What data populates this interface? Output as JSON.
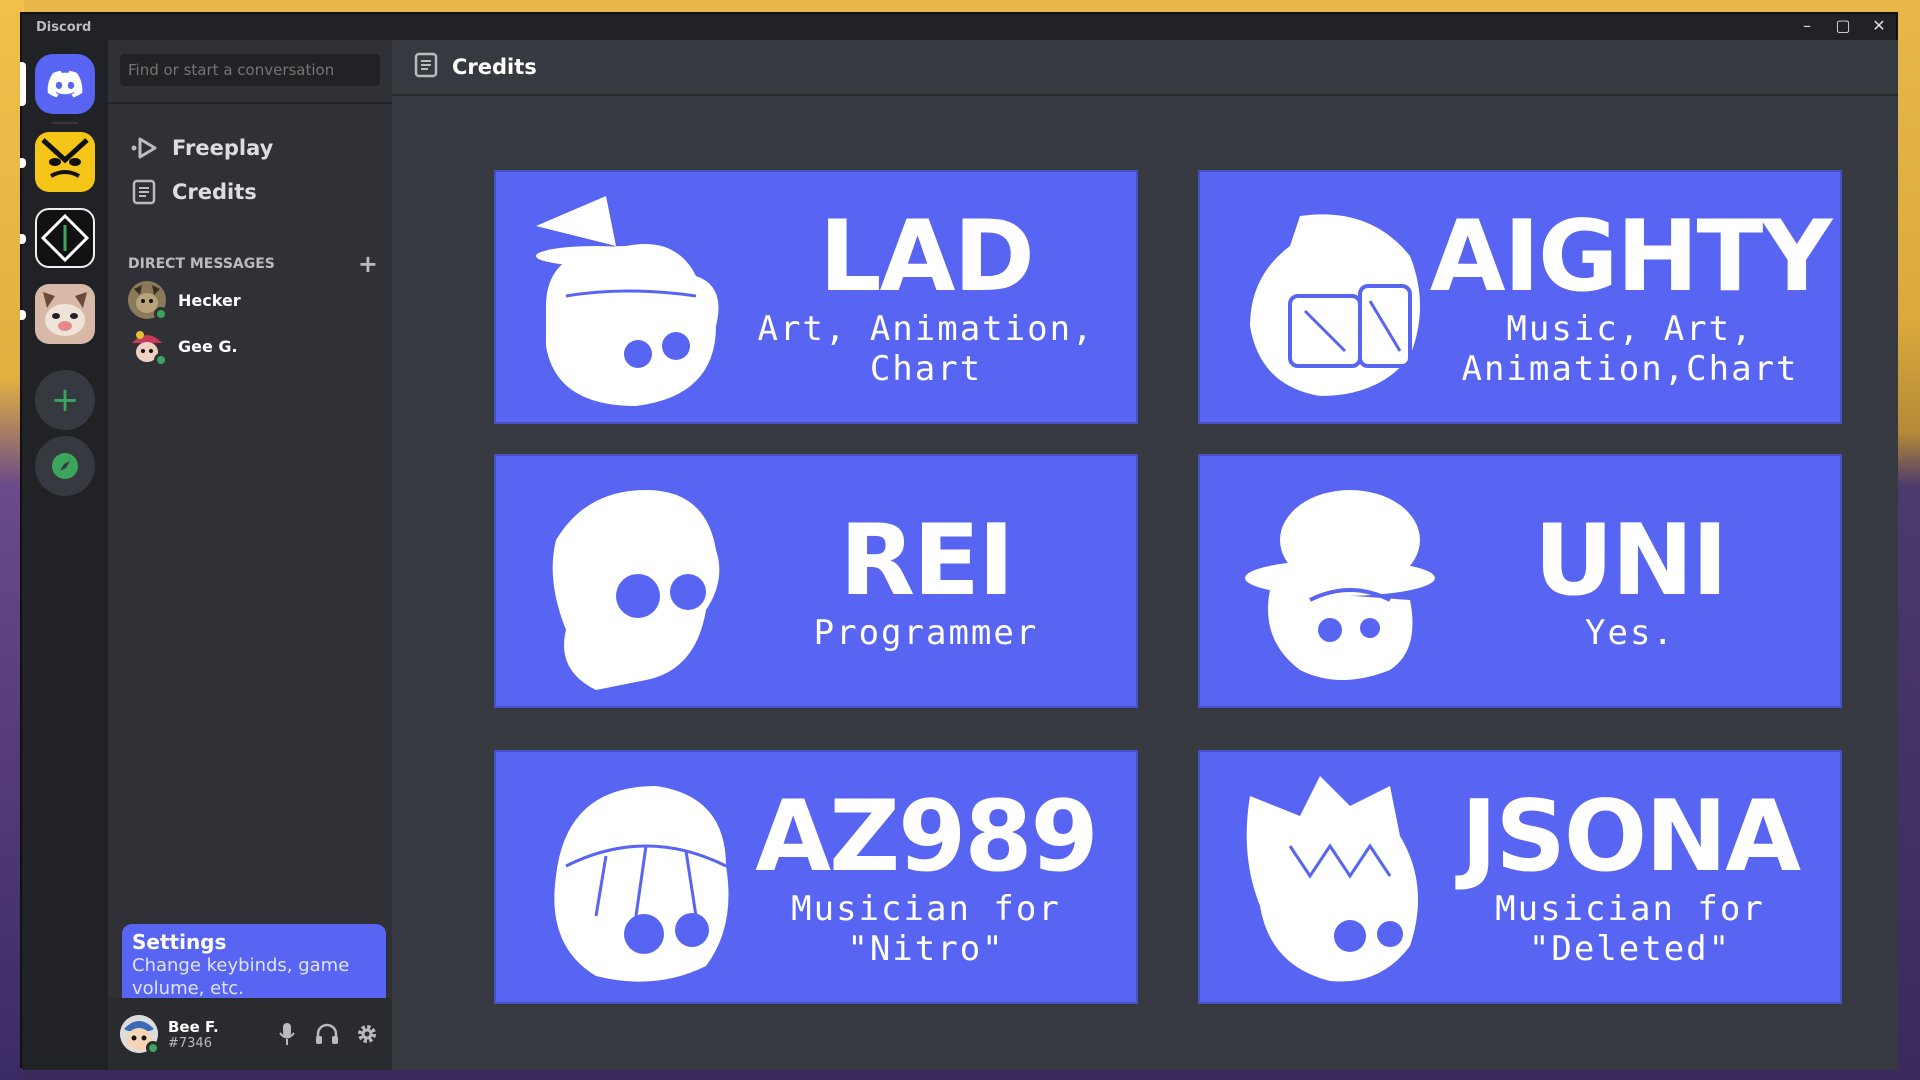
{
  "window": {
    "title": "Discord",
    "controls": {
      "minimize": "–",
      "maximize": "▢",
      "close": "✕"
    }
  },
  "colors": {
    "blurple": "#5865f2",
    "green": "#3ba55d",
    "rail": "#202225",
    "sidebar": "#2f3136",
    "main": "#36393f"
  },
  "rail": {
    "servers": [
      {
        "name": "Discord Home",
        "icon": "discord-logo-icon"
      },
      {
        "name": "Angry face server",
        "icon": "angry-face-icon"
      },
      {
        "name": "Diamond server",
        "icon": "diamond-icon"
      },
      {
        "name": "Cat server",
        "icon": "cat-face-icon"
      }
    ],
    "add_label": "+",
    "explore_icon": "compass-icon"
  },
  "sidebar": {
    "search_placeholder": "Find or start a conversation",
    "nav": [
      {
        "label": "Freeplay",
        "icon": "play-icon"
      },
      {
        "label": "Credits",
        "icon": "document-icon"
      }
    ],
    "dm_header": "DIRECT MESSAGES",
    "dm_add": "+",
    "dms": [
      {
        "name": "Hecker"
      },
      {
        "name": "Gee G."
      }
    ],
    "tooltip": {
      "title": "Settings",
      "description": "Change keybinds, game volume, etc."
    },
    "user": {
      "name": "Bee F.",
      "tag": "#7346"
    }
  },
  "main": {
    "header_title": "Credits",
    "header_icon": "document-icon",
    "cards": [
      {
        "name": "LAD",
        "role": "Art, Animation,\nChart"
      },
      {
        "name": "AIGHTY",
        "role": "Music, Art,\nAnimation,Chart"
      },
      {
        "name": "REI",
        "role": "Programmer"
      },
      {
        "name": "UNI",
        "role": "Yes."
      },
      {
        "name": "AZ989",
        "role": "Musician for\n\"Nitro\""
      },
      {
        "name": "JSONA",
        "role": "Musician for\n\"Deleted\""
      }
    ]
  }
}
